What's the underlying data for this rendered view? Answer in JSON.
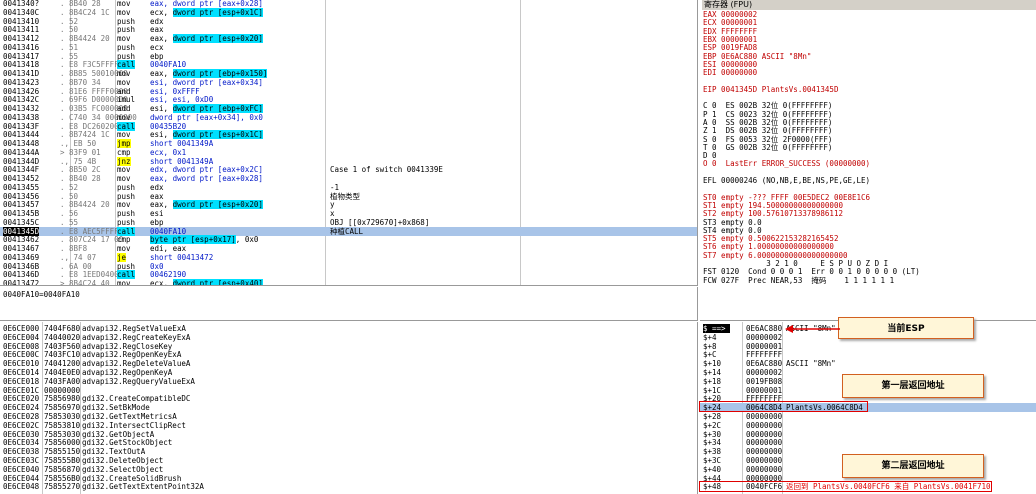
{
  "disasm": {
    "rows": [
      {
        "addr": "0041340?",
        "hex": ". 8B40 28",
        "mn": "mov",
        "op": "eax, dword ptr [eax+0x28]",
        "comment": ""
      },
      {
        "addr": "0041340C",
        "hex": ". 8B4C24 1C",
        "mn": "mov",
        "op": "ecx, dword ptr [esp+0x1C]",
        "comment": "",
        "opHl": "dword ptr [esp+0x1C]"
      },
      {
        "addr": "00413410",
        "hex": ". 52",
        "mn": "push",
        "op": "edx",
        "comment": ""
      },
      {
        "addr": "00413411",
        "hex": ". 50",
        "mn": "push",
        "op": "eax",
        "comment": ""
      },
      {
        "addr": "00413412",
        "hex": ". 8B4424 20",
        "mn": "mov",
        "op": "eax, dword ptr [esp+0x20]",
        "comment": "",
        "opHl": "dword ptr [esp+0x20]"
      },
      {
        "addr": "00413416",
        "hex": ". 51",
        "mn": "push",
        "op": "ecx",
        "comment": ""
      },
      {
        "addr": "00413417",
        "hex": ". 55",
        "mn": "push",
        "op": "ebp",
        "comment": ""
      },
      {
        "addr": "00413418",
        "hex": ". E8 F3C5FFFF",
        "mn": "call",
        "op": "0040FA10",
        "comment": "",
        "mnHl": true
      },
      {
        "addr": "0041341D",
        "hex": ". 8B85 50010000",
        "mn": "mov",
        "op": "eax, dword ptr [ebp+0x150]",
        "comment": "",
        "opHl": "dword ptr [ebp+0x150]"
      },
      {
        "addr": "00413423",
        "hex": ". 8B70 34",
        "mn": "mov",
        "op": "esi, dword ptr [eax+0x34]",
        "comment": ""
      },
      {
        "addr": "00413426",
        "hex": ". 81E6 FFFF0000",
        "mn": "and",
        "op": "esi, 0xFFFF",
        "comment": ""
      },
      {
        "addr": "0041342C",
        "hex": ". 69F6 D0000000",
        "mn": "imul",
        "op": "esi, esi, 0xD0",
        "comment": ""
      },
      {
        "addr": "00413432",
        "hex": ". 03B5 FC000000",
        "mn": "add",
        "op": "esi, dword ptr [ebp+0xFC]",
        "comment": "",
        "opHl": "dword ptr [ebp+0xFC]"
      },
      {
        "addr": "00413438",
        "hex": ". C740 34 0000000",
        "mn": "mov",
        "op": "dword ptr [eax+0x34], 0x0",
        "comment": ""
      },
      {
        "addr": "0041343F",
        "hex": ". E8 DC260200",
        "mn": "call",
        "op": "00435B20",
        "comment": "",
        "mnHl": true
      },
      {
        "addr": "00413444",
        "hex": ". 8B7424 1C",
        "mn": "mov",
        "op": "esi, dword ptr [esp+0x1C]",
        "comment": "",
        "opHl": "dword ptr [esp+0x1C]"
      },
      {
        "addr": "00413448",
        "hex": "., EB 50",
        "mn": "jmp",
        "op": "short 0041349A",
        "comment": "",
        "mnYel": true
      },
      {
        "addr": "0041344A",
        "hex": "> 83F9 01",
        "mn": "cmp",
        "op": "ecx, 0x1",
        "comment": ""
      },
      {
        "addr": "0041344D",
        "hex": "., 75 4B",
        "mn": "jnz",
        "op": "short 0041349A",
        "comment": "",
        "mnYel": true
      },
      {
        "addr": "0041344F",
        "hex": ". 8B50 2C",
        "mn": "mov",
        "op": "edx, dword ptr [eax+0x2C]",
        "comment": "Case 1 of switch 0041339E"
      },
      {
        "addr": "00413452",
        "hex": ". 8B40 28",
        "mn": "mov",
        "op": "eax, dword ptr [eax+0x28]",
        "comment": ""
      },
      {
        "addr": "00413455",
        "hex": ". 52",
        "mn": "push",
        "op": "edx",
        "comment": "-1"
      },
      {
        "addr": "00413456",
        "hex": ". 50",
        "mn": "push",
        "op": "eax",
        "comment": "植物类型"
      },
      {
        "addr": "00413457",
        "hex": ". 8B4424 20",
        "mn": "mov",
        "op": "eax, dword ptr [esp+0x20]",
        "comment": "y",
        "opHl": "dword ptr [esp+0x20]"
      },
      {
        "addr": "0041345B",
        "hex": ". 56",
        "mn": "push",
        "op": "esi",
        "comment": "x"
      },
      {
        "addr": "0041345C",
        "hex": ". 55",
        "mn": "push",
        "op": "ebp",
        "comment": "OBJ [[0x729670]+0x868]"
      },
      {
        "addr": "0041345D",
        "hex": ". E8 AEC5FFFF",
        "mn": "call",
        "op": "0040FA10",
        "comment": "种植CALL",
        "sel": true,
        "mnHl": true
      },
      {
        "addr": "00413462",
        "hex": ". 807C24 17 00",
        "mn": "cmp",
        "op": "byte ptr [esp+0x17], 0x0",
        "comment": "",
        "opHl": "byte ptr [esp+0x17]"
      },
      {
        "addr": "00413467",
        "hex": ". 8BF8",
        "mn": "mov",
        "op": "edi, eax",
        "comment": ""
      },
      {
        "addr": "00413469",
        "hex": "., 74 07",
        "mn": "je",
        "op": "short 00413472",
        "comment": "",
        "mnYel": true
      },
      {
        "addr": "0041346B",
        "hex": ". 6A 00",
        "mn": "push",
        "op": "0x0",
        "comment": ""
      },
      {
        "addr": "0041346D",
        "hex": ". E8 1EED0400",
        "mn": "call",
        "op": "00462190",
        "comment": "",
        "mnHl": true
      },
      {
        "addr": "00413472",
        "hex": "> 8B4C24 40",
        "mn": "mov",
        "op": "ecx, dword ptr [esp+0x40]",
        "comment": "",
        "opHl": "dword ptr [esp+0x40]"
      }
    ],
    "info_line": "0040FA10=0040FA10"
  },
  "registers": {
    "title": "寄存器 (FPU)",
    "lines": [
      "EAX 00000002",
      "ECX 00000001",
      "EDX FFFFFFFF",
      "EBX 00000001",
      "ESP 0019FAD8",
      "EBP 0E6AC880 ASCII \"8Mn\"",
      "ESI 00000000",
      "EDI 00000000",
      "",
      "EIP 0041345D PlantsVs.0041345D",
      "",
      "C 0  ES 002B 32位 0(FFFFFFFF)",
      "P 1  CS 0023 32位 0(FFFFFFFF)",
      "A 0  SS 002B 32位 0(FFFFFFFF)",
      "Z 1  DS 002B 32位 0(FFFFFFFF)",
      "S 0  FS 0053 32位 2F0000(FFF)",
      "T 0  GS 002B 32位 0(FFFFFFFF)",
      "D 0",
      "O 0  LastErr ERROR_SUCCESS (00000000)",
      "",
      "EFL 00000246 (NO,NB,E,BE,NS,PE,GE,LE)",
      "",
      "ST0 empty -??? FFFF 00E5DEC2 00E8E1C6",
      "ST1 empty 194.50000000000000000",
      "ST2 empty 100.57610713378986112",
      "ST3 empty 0.0",
      "ST4 empty 0.0",
      "ST5 empty 0.500622153282165452",
      "ST6 empty 1.00000000000000000",
      "ST7 empty 6.00000000000000000000",
      "              3 2 1 0     E S P U O Z D I",
      "FST 0120  Cond 0 0 0 1  Err 0 0 1 0 0 0 0 0 (LT)",
      "FCW 027F  Prec NEAR,53  掩码    1 1 1 1 1 1"
    ]
  },
  "dump": {
    "rows": [
      {
        "addr": "0E6CE000",
        "val": "7404F680",
        "txt": "advapi32.RegSetValueExA"
      },
      {
        "addr": "0E6CE004",
        "val": "74040020",
        "txt": "advapi32.RegCreateKeyExA"
      },
      {
        "addr": "0E6CE008",
        "val": "7403F560",
        "txt": "advapi32.RegCloseKey"
      },
      {
        "addr": "0E6CE00C",
        "val": "7403FC10",
        "txt": "advapi32.RegOpenKeyExA"
      },
      {
        "addr": "0E6CE010",
        "val": "74041200",
        "txt": "advapi32.RegDeleteValueA"
      },
      {
        "addr": "0E6CE014",
        "val": "7404E0E0",
        "txt": "advapi32.RegOpenKeyA"
      },
      {
        "addr": "0E6CE018",
        "val": "7403FA00",
        "txt": "advapi32.RegQueryValueExA"
      },
      {
        "addr": "0E6CE01C",
        "val": "00000000",
        "txt": ""
      },
      {
        "addr": "0E6CE020",
        "val": "75856980",
        "txt": "gdi32.CreateCompatibleDC"
      },
      {
        "addr": "0E6CE024",
        "val": "75856970",
        "txt": "gdi32.SetBkMode"
      },
      {
        "addr": "0E6CE028",
        "val": "75853030",
        "txt": "gdi32.GetTextMetricsA"
      },
      {
        "addr": "0E6CE02C",
        "val": "75853810",
        "txt": "gdi32.IntersectClipRect"
      },
      {
        "addr": "0E6CE030",
        "val": "75853030",
        "txt": "gdi32.GetObjectA"
      },
      {
        "addr": "0E6CE034",
        "val": "75856000",
        "txt": "gdi32.GetStockObject"
      },
      {
        "addr": "0E6CE038",
        "val": "75855150",
        "txt": "gdi32.TextOutA"
      },
      {
        "addr": "0E6CE03C",
        "val": "758555B0",
        "txt": "gdi32.DeleteObject"
      },
      {
        "addr": "0E6CE040",
        "val": "75856870",
        "txt": "gdi32.SelectObject"
      },
      {
        "addr": "0E6CE044",
        "val": "758556B0",
        "txt": "gdi32.CreateSolidBrush"
      },
      {
        "addr": "0E6CE048",
        "val": "75855270",
        "txt": "gdi32.GetTextExtentPoint32A"
      }
    ]
  },
  "stack": {
    "rows": [
      {
        "off": "$ ==>",
        "val": "0E6AC880",
        "txt": "ASCII \"8Mn\""
      },
      {
        "off": "$+4",
        "val": "00000002",
        "txt": ""
      },
      {
        "off": "$+8",
        "val": "00000001",
        "txt": ""
      },
      {
        "off": "$+C",
        "val": "FFFFFFFF",
        "txt": ""
      },
      {
        "off": "$+10",
        "val": "0E6AC880",
        "txt": "ASCII \"8Mn\""
      },
      {
        "off": "$+14",
        "val": "00000002",
        "txt": ""
      },
      {
        "off": "$+18",
        "val": "0019FB08",
        "txt": ""
      },
      {
        "off": "$+1C",
        "val": "00000001",
        "txt": ""
      },
      {
        "off": "$+20",
        "val": "FFFFFFFF",
        "txt": ""
      },
      {
        "off": "$+24",
        "val": "0064C8D4",
        "txt": "PlantsVs.0064C8D4",
        "sel": true
      },
      {
        "off": "$+28",
        "val": "00000000",
        "txt": ""
      },
      {
        "off": "$+2C",
        "val": "00000000",
        "txt": ""
      },
      {
        "off": "$+30",
        "val": "00000000",
        "txt": ""
      },
      {
        "off": "$+34",
        "val": "00000000",
        "txt": ""
      },
      {
        "off": "$+38",
        "val": "00000000",
        "txt": ""
      },
      {
        "off": "$+3C",
        "val": "00000000",
        "txt": ""
      },
      {
        "off": "$+40",
        "val": "00000000",
        "txt": ""
      },
      {
        "off": "$+44",
        "val": "00000000",
        "txt": ""
      },
      {
        "off": "$+48",
        "val": "0040FCF6",
        "txt": "返回到 PlantsVs.0040FCF6 来自 PlantsVs.0041F710",
        "redtxt": true
      }
    ]
  },
  "annotations": {
    "esp": "当前ESP",
    "ret1": "第一层返回地址",
    "ret2": "第二层返回地址"
  },
  "colors": {
    "highlight": "#00e0ff",
    "jump": "#ffff00",
    "selected": "#a8c4e8",
    "annotation_border": "#d26020"
  }
}
